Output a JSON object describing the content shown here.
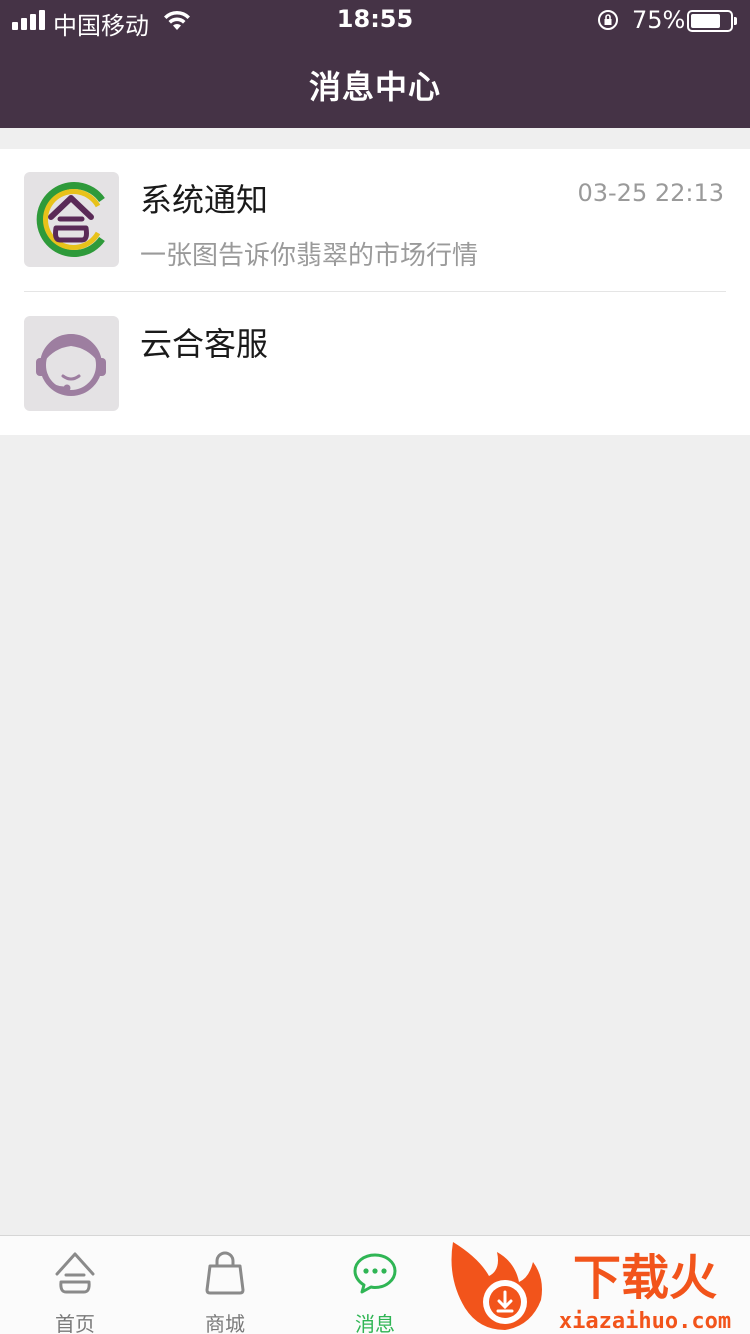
{
  "status_bar": {
    "carrier": "中国移动",
    "time": "18:55",
    "battery_percent": "75%",
    "battery_level": 0.75,
    "icons": [
      "signal-icon",
      "wifi-icon",
      "rotation-lock-icon",
      "battery-icon"
    ]
  },
  "header": {
    "title": "消息中心",
    "background": "#453346"
  },
  "messages": [
    {
      "title": "系统通知",
      "time": "03-25 22:13",
      "preview": "一张图告诉你翡翠的市场行情",
      "avatar_icon": "yunhe-logo-icon"
    },
    {
      "title": "云合客服",
      "time": "",
      "preview": "",
      "avatar_icon": "customer-service-icon"
    }
  ],
  "tabbar": {
    "items": [
      {
        "label": "首页",
        "icon": "home-logo-icon",
        "active": false
      },
      {
        "label": "商城",
        "icon": "shopping-bag-icon",
        "active": false
      },
      {
        "label": "消息",
        "icon": "chat-bubble-icon",
        "active": true
      }
    ],
    "active_color": "#2fb554",
    "inactive_color": "#7a7a7a"
  },
  "watermark": {
    "brand": "下载火",
    "url": "xiazaihuo.com"
  }
}
